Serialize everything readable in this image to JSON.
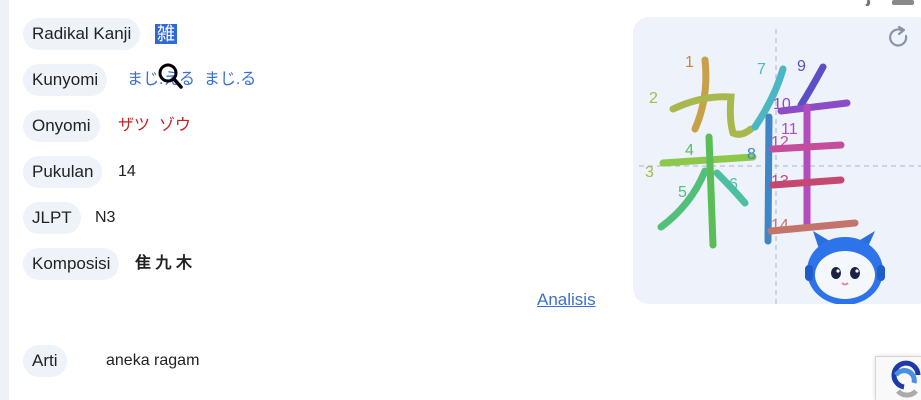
{
  "rows": {
    "radikal": {
      "label": "Radikal Kanji",
      "value": "雑"
    },
    "kunyomi": {
      "label": "Kunyomi",
      "value_1": "まじ.える",
      "value_2": "まじ.る"
    },
    "onyomi": {
      "label": "Onyomi",
      "value_1": "ザツ",
      "value_2": "ゾウ"
    },
    "pukulan": {
      "label": "Pukulan",
      "value": "14"
    },
    "jlpt": {
      "label": "JLPT",
      "value": "N3"
    },
    "komposisi": {
      "label": "Komposisi",
      "parts": [
        "隹",
        "九",
        "木"
      ]
    },
    "arti": {
      "label": "Arti",
      "value": "aneka ragam"
    }
  },
  "analisis_link": "Analisis",
  "stroke_numbers": [
    "1",
    "2",
    "3",
    "4",
    "5",
    "6",
    "7",
    "8",
    "9",
    "10",
    "11",
    "12",
    "13",
    "14"
  ],
  "icons": {
    "replay": "replay-icon",
    "cursor": "magnifier-cursor-icon",
    "mascot": "robot-mascot-icon",
    "recaptcha": "recaptcha-icon"
  },
  "colors": {
    "pill_bg": "#eef2f9",
    "kunyomi": "#3a6fd0",
    "onyomi": "#c42323",
    "panel_bg": "#edf2fb",
    "selection": "#3267d6"
  }
}
